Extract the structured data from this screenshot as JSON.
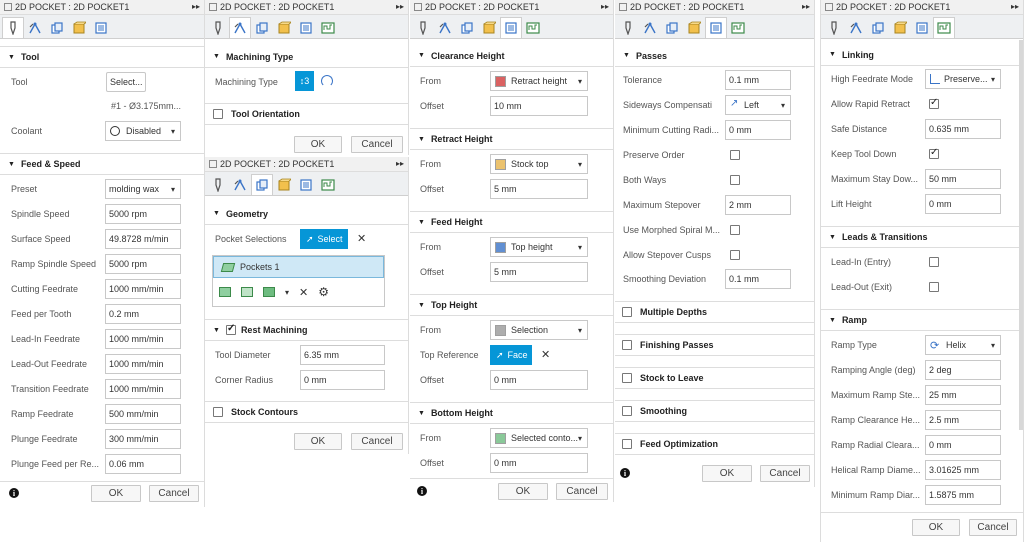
{
  "window_title": "2D POCKET : 2D POCKET1",
  "ok": "OK",
  "cancel": "Cancel",
  "panel1": {
    "tool_section": "Tool",
    "tool_label": "Tool",
    "tool_button": "Select...",
    "tool_desc": "#1 - Ø3.175mm...",
    "coolant_label": "Coolant",
    "coolant_value": "Disabled",
    "feed_section": "Feed & Speed",
    "fields": [
      {
        "label": "Preset",
        "value": "molding wax"
      },
      {
        "label": "Spindle Speed",
        "value": "5000 rpm"
      },
      {
        "label": "Surface Speed",
        "value": "49.8728 m/min"
      },
      {
        "label": "Ramp Spindle Speed",
        "value": "5000 rpm"
      },
      {
        "label": "Cutting Feedrate",
        "value": "1000 mm/min"
      },
      {
        "label": "Feed per Tooth",
        "value": "0.2 mm"
      },
      {
        "label": "Lead-In Feedrate",
        "value": "1000 mm/min"
      },
      {
        "label": "Lead-Out Feedrate",
        "value": "1000 mm/min"
      },
      {
        "label": "Transition Feedrate",
        "value": "1000 mm/min"
      },
      {
        "label": "Ramp Feedrate",
        "value": "500 mm/min"
      },
      {
        "label": "Plunge Feedrate",
        "value": "300 mm/min"
      },
      {
        "label": "Plunge Feed per Re...",
        "value": "0.06 mm"
      }
    ]
  },
  "panel2a": {
    "machining_type_section": "Machining Type",
    "machining_type_label": "Machining Type",
    "tool_orientation": "Tool Orientation"
  },
  "panel2b": {
    "geometry_section": "Geometry",
    "pocket_selections_label": "Pocket Selections",
    "select_button": "Select",
    "pockets_item": "Pockets 1",
    "rest_machining": "Rest Machining",
    "tool_diameter_label": "Tool Diameter",
    "tool_diameter_value": "6.35 mm",
    "corner_radius_label": "Corner Radius",
    "corner_radius_value": "0 mm",
    "stock_contours": "Stock Contours"
  },
  "panel3": {
    "groups": [
      {
        "title": "Clearance Height",
        "from_label": "From",
        "from_value": "Retract height",
        "offset_label": "Offset",
        "offset_value": "10 mm"
      },
      {
        "title": "Retract Height",
        "from_label": "From",
        "from_value": "Stock top",
        "offset_label": "Offset",
        "offset_value": "5 mm"
      },
      {
        "title": "Feed Height",
        "from_label": "From",
        "from_value": "Top height",
        "offset_label": "Offset",
        "offset_value": "5 mm"
      },
      {
        "title": "Top Height",
        "from_label": "From",
        "from_value": "Selection",
        "offset_label": "Offset",
        "offset_value": "0 mm"
      },
      {
        "title": "Bottom Height",
        "from_label": "From",
        "from_value": "Selected conto...",
        "offset_label": "Offset",
        "offset_value": "0 mm"
      }
    ],
    "top_reference_label": "Top Reference",
    "face_button": "Face"
  },
  "panel4": {
    "passes_section": "Passes",
    "tolerance_label": "Tolerance",
    "tolerance_value": "0.1 mm",
    "sideways_label": "Sideways Compensati",
    "sideways_value": "Left",
    "min_cut_radius_label": "Minimum Cutting Radi...",
    "min_cut_radius_value": "0 mm",
    "preserve_order": "Preserve Order",
    "both_ways": "Both Ways",
    "max_stepover_label": "Maximum Stepover",
    "max_stepover_value": "2 mm",
    "use_morphed": "Use Morphed Spiral M...",
    "allow_stepover_cusps": "Allow Stepover Cusps",
    "smoothing_dev_label": "Smoothing Deviation",
    "smoothing_dev_value": "0.1 mm",
    "multiple_depths": "Multiple Depths",
    "finishing_passes": "Finishing Passes",
    "stock_to_leave": "Stock to Leave",
    "smoothing": "Smoothing",
    "feed_optimization": "Feed Optimization"
  },
  "panel5": {
    "linking_section": "Linking",
    "high_feed_label": "High Feedrate Mode",
    "high_feed_value": "Preserve...",
    "allow_rapid": "Allow Rapid Retract",
    "safe_distance_label": "Safe Distance",
    "safe_distance_value": "0.635 mm",
    "keep_tool_down": "Keep Tool Down",
    "max_stay_label": "Maximum Stay Dow...",
    "max_stay_value": "50 mm",
    "lift_height_label": "Lift Height",
    "lift_height_value": "0 mm",
    "leads_section": "Leads & Transitions",
    "lead_in": "Lead-In (Entry)",
    "lead_out": "Lead-Out (Exit)",
    "ramp_section": "Ramp",
    "ramp_type_label": "Ramp Type",
    "ramp_type_value": "Helix",
    "ramp_fields": [
      {
        "label": "Ramping Angle (deg)",
        "value": "2 deg"
      },
      {
        "label": "Maximum Ramp Ste...",
        "value": "25 mm"
      },
      {
        "label": "Ramp Clearance He...",
        "value": "2.5 mm"
      },
      {
        "label": "Ramp Radial Cleara...",
        "value": "0 mm"
      },
      {
        "label": "Helical Ramp Diame...",
        "value": "3.01625 mm"
      },
      {
        "label": "Minimum Ramp Diar...",
        "value": "1.5875 mm"
      }
    ]
  }
}
